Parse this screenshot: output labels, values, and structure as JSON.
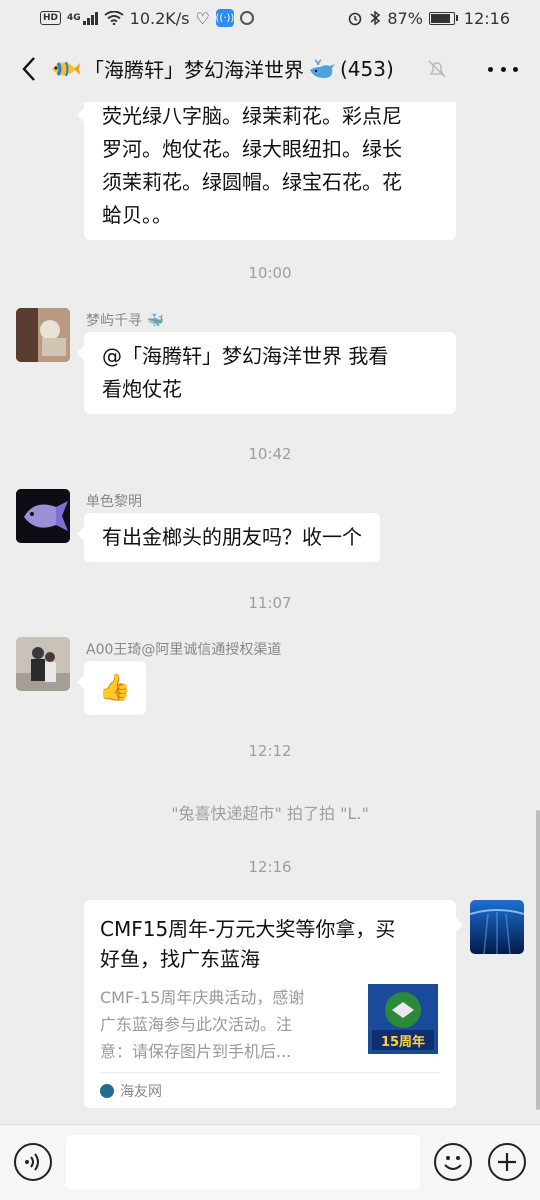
{
  "status_bar": {
    "hd_badge": "HD",
    "network": "4G",
    "speed": "10.2K/s",
    "battery": "87%",
    "battery_level": 0.87,
    "time": "12:16"
  },
  "header": {
    "title": "「海腾轩」梦幻海洋世界",
    "member_count": "(453)"
  },
  "messages": [
    {
      "kind": "text",
      "side": "left",
      "lines": [
        "荧光绿八字脑。绿茉莉花。彩点尼",
        "罗河。炮仗花。绿大眼纽扣。绿长",
        "须茉莉花。绿圆帽。绿宝石花。花",
        "蛤贝。。"
      ]
    },
    {
      "kind": "time",
      "text": "10:00"
    },
    {
      "kind": "text",
      "side": "left",
      "sender": "梦屿千寻",
      "lines": [
        "@「海腾轩」梦幻海洋世界  我看",
        "看炮仗花"
      ]
    },
    {
      "kind": "time",
      "text": "10:42"
    },
    {
      "kind": "text",
      "side": "left",
      "sender": "单色黎明",
      "lines": [
        "有出金榔头的朋友吗？收一个"
      ]
    },
    {
      "kind": "time",
      "text": "11:07"
    },
    {
      "kind": "emoji",
      "side": "left",
      "sender": "A00王琦@阿里诚信通授权渠道",
      "emoji": "👍"
    },
    {
      "kind": "time",
      "text": "12:12"
    },
    {
      "kind": "system",
      "text": "\"兔喜快递超市\" 拍了拍 \"L.\""
    },
    {
      "kind": "time",
      "text": "12:16"
    },
    {
      "kind": "link_card",
      "side": "right",
      "title_lines": [
        "CMF15周年-万元大奖等你拿，买",
        "好鱼，找广东蓝海"
      ],
      "desc_lines": [
        "CMF-15周年庆典活动，感谢",
        "广东蓝海参与此次活动。注",
        "意：请保存图片到手机后..."
      ],
      "thumb_text": "15周年",
      "source": "海友网"
    }
  ],
  "colors": {
    "background": "#ededed",
    "bubble": "#ffffff",
    "muted": "#9e9e9e"
  }
}
